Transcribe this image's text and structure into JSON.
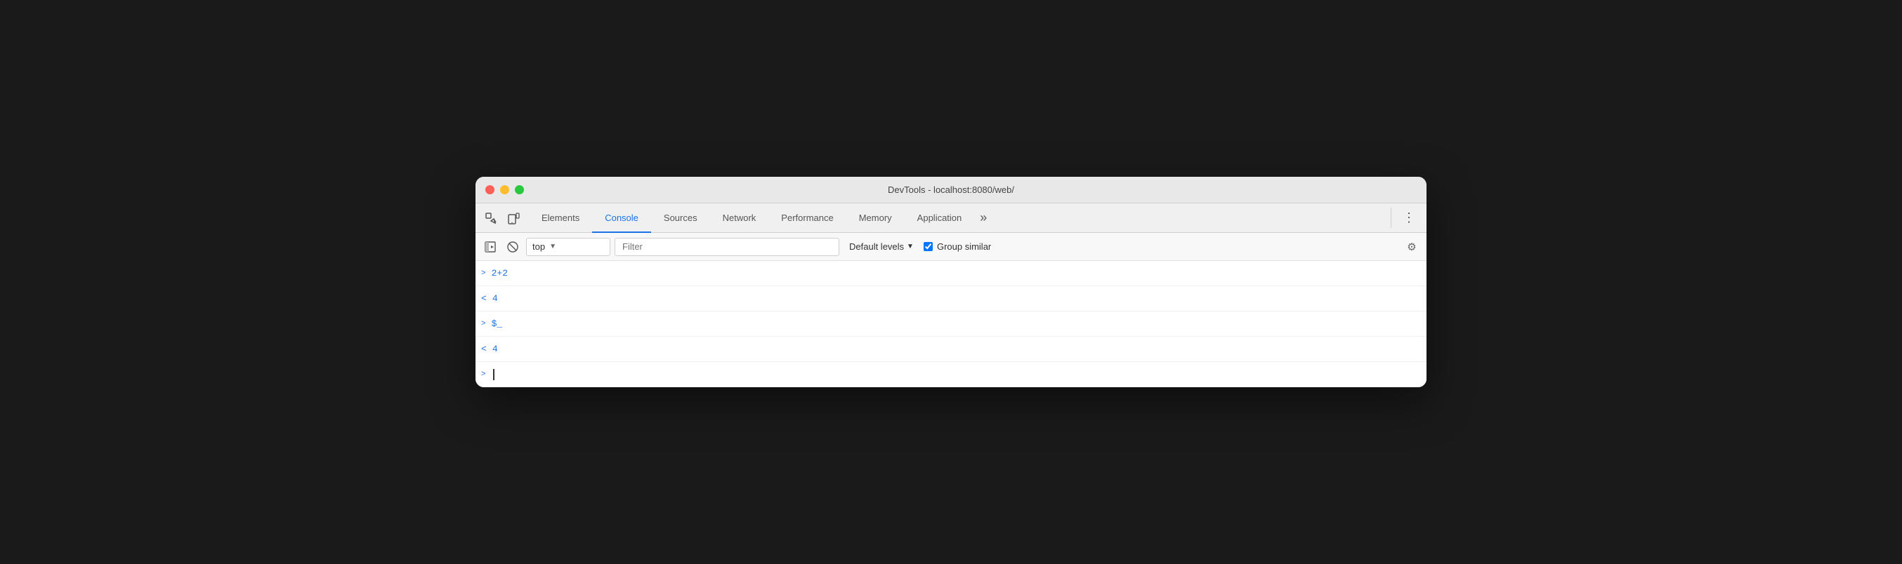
{
  "window": {
    "title": "DevTools - localhost:8080/web/"
  },
  "tabs": [
    {
      "id": "elements",
      "label": "Elements",
      "active": false
    },
    {
      "id": "console",
      "label": "Console",
      "active": true
    },
    {
      "id": "sources",
      "label": "Sources",
      "active": false
    },
    {
      "id": "network",
      "label": "Network",
      "active": false
    },
    {
      "id": "performance",
      "label": "Performance",
      "active": false
    },
    {
      "id": "memory",
      "label": "Memory",
      "active": false
    },
    {
      "id": "application",
      "label": "Application",
      "active": false
    }
  ],
  "console_toolbar": {
    "context_value": "top",
    "context_placeholder": "top",
    "filter_placeholder": "Filter",
    "levels_label": "Default levels",
    "group_similar_label": "Group similar"
  },
  "console_lines": [
    {
      "type": "input",
      "arrow": ">",
      "text": "2+2"
    },
    {
      "type": "output",
      "arrow": "<",
      "text": "4"
    },
    {
      "type": "input",
      "arrow": ">",
      "text": "$_"
    },
    {
      "type": "output",
      "arrow": "<",
      "text": "4"
    }
  ],
  "icons": {
    "inspector": "⬚",
    "device": "⧉",
    "more": "»",
    "vertical_dots": "⋮",
    "console_sidebar": "▶|",
    "clear": "⊘",
    "dropdown_arrow": "▼",
    "settings": "⚙"
  }
}
